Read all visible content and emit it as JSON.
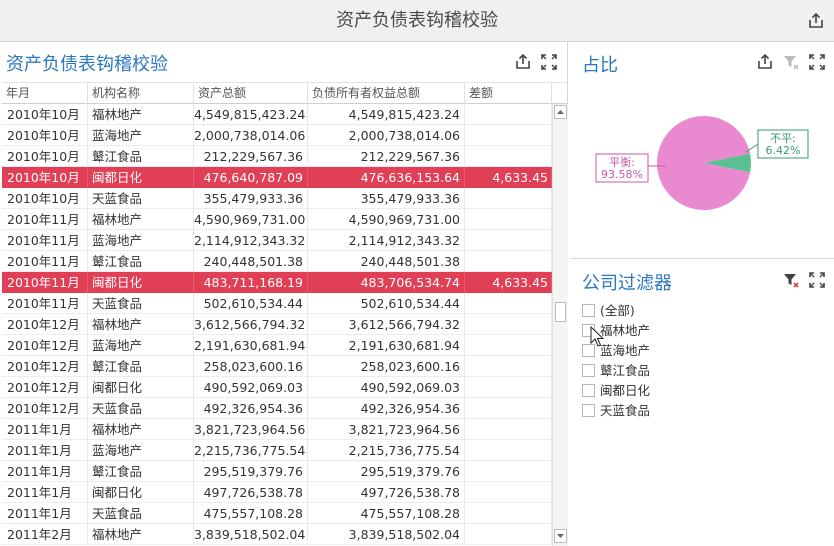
{
  "window": {
    "title": "资产负债表钩稽校验"
  },
  "grid_panel": {
    "title": "资产负债表钩稽校验",
    "columns": [
      "年月",
      "机构名称",
      "资产总额",
      "负债所有者权益总额",
      "差额"
    ],
    "rows": [
      {
        "date": "2010年10月",
        "org": "福林地产",
        "asset": "4,549,815,423.24",
        "equity": "4,549,815,423.24",
        "diff": "",
        "highlight": false
      },
      {
        "date": "2010年10月",
        "org": "蓝海地产",
        "asset": "2,000,738,014.06",
        "equity": "2,000,738,014.06",
        "diff": "",
        "highlight": false
      },
      {
        "date": "2010年10月",
        "org": "鼙江食品",
        "asset": "212,229,567.36",
        "equity": "212,229,567.36",
        "diff": "",
        "highlight": false
      },
      {
        "date": "2010年10月",
        "org": "闽都日化",
        "asset": "476,640,787.09",
        "equity": "476,636,153.64",
        "diff": "4,633.45",
        "highlight": true
      },
      {
        "date": "2010年10月",
        "org": "天蓝食品",
        "asset": "355,479,933.36",
        "equity": "355,479,933.36",
        "diff": "",
        "highlight": false
      },
      {
        "date": "2010年11月",
        "org": "福林地产",
        "asset": "4,590,969,731.00",
        "equity": "4,590,969,731.00",
        "diff": "",
        "highlight": false
      },
      {
        "date": "2010年11月",
        "org": "蓝海地产",
        "asset": "2,114,912,343.32",
        "equity": "2,114,912,343.32",
        "diff": "",
        "highlight": false
      },
      {
        "date": "2010年11月",
        "org": "鼙江食品",
        "asset": "240,448,501.38",
        "equity": "240,448,501.38",
        "diff": "",
        "highlight": false
      },
      {
        "date": "2010年11月",
        "org": "闽都日化",
        "asset": "483,711,168.19",
        "equity": "483,706,534.74",
        "diff": "4,633.45",
        "highlight": true
      },
      {
        "date": "2010年11月",
        "org": "天蓝食品",
        "asset": "502,610,534.44",
        "equity": "502,610,534.44",
        "diff": "",
        "highlight": false
      },
      {
        "date": "2010年12月",
        "org": "福林地产",
        "asset": "3,612,566,794.32",
        "equity": "3,612,566,794.32",
        "diff": "",
        "highlight": false
      },
      {
        "date": "2010年12月",
        "org": "蓝海地产",
        "asset": "2,191,630,681.94",
        "equity": "2,191,630,681.94",
        "diff": "",
        "highlight": false
      },
      {
        "date": "2010年12月",
        "org": "鼙江食品",
        "asset": "258,023,600.16",
        "equity": "258,023,600.16",
        "diff": "",
        "highlight": false
      },
      {
        "date": "2010年12月",
        "org": "闽都日化",
        "asset": "490,592,069.03",
        "equity": "490,592,069.03",
        "diff": "",
        "highlight": false
      },
      {
        "date": "2010年12月",
        "org": "天蓝食品",
        "asset": "492,326,954.36",
        "equity": "492,326,954.36",
        "diff": "",
        "highlight": false
      },
      {
        "date": "2011年1月",
        "org": "福林地产",
        "asset": "3,821,723,964.56",
        "equity": "3,821,723,964.56",
        "diff": "",
        "highlight": false
      },
      {
        "date": "2011年1月",
        "org": "蓝海地产",
        "asset": "2,215,736,775.54",
        "equity": "2,215,736,775.54",
        "diff": "",
        "highlight": false
      },
      {
        "date": "2011年1月",
        "org": "鼙江食品",
        "asset": "295,519,379.76",
        "equity": "295,519,379.76",
        "diff": "",
        "highlight": false
      },
      {
        "date": "2011年1月",
        "org": "闽都日化",
        "asset": "497,726,538.78",
        "equity": "497,726,538.78",
        "diff": "",
        "highlight": false
      },
      {
        "date": "2011年1月",
        "org": "天蓝食品",
        "asset": "475,557,108.28",
        "equity": "475,557,108.28",
        "diff": "",
        "highlight": false
      },
      {
        "date": "2011年2月",
        "org": "福林地产",
        "asset": "3,839,518,502.04",
        "equity": "3,839,518,502.04",
        "diff": "",
        "highlight": false
      }
    ],
    "highlight_color": "#e13f55"
  },
  "pie_panel": {
    "title": "占比"
  },
  "chart_data": {
    "type": "pie",
    "title": "占比",
    "slices": [
      {
        "label": "平衡:",
        "pct_text": "93.58%",
        "value": 93.58,
        "color": "#e98ad0"
      },
      {
        "label": "不平:",
        "pct_text": "6.42%",
        "value": 6.42,
        "color": "#5cbf92"
      }
    ]
  },
  "filter_panel": {
    "title": "公司过滤器",
    "items": [
      "(全部)",
      "福林地产",
      "蓝海地产",
      "鼙江食品",
      "闽都日化",
      "天蓝食品"
    ]
  },
  "icons": {
    "export": "export-icon",
    "maximize": "maximize-icon",
    "clear_filter": "clear-filter-icon"
  }
}
